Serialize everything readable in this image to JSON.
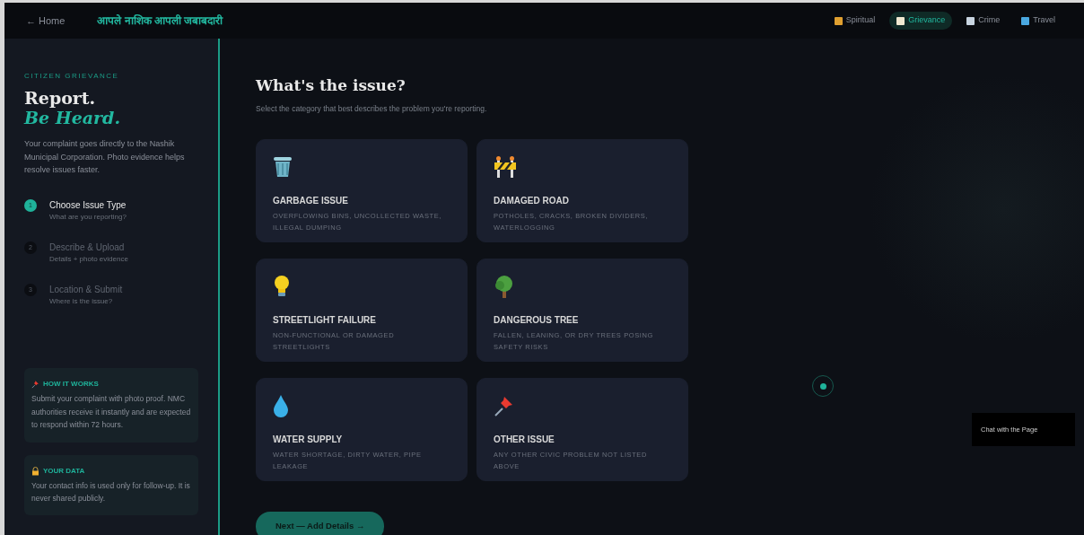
{
  "header": {
    "back": "← Home",
    "brand": "आपले नाशिक आपली जबाबदारी",
    "nav": [
      {
        "label": "Spiritual",
        "color": "#e0a030",
        "selected": false
      },
      {
        "label": "Grievance",
        "color": "#f0e8d0",
        "selected": true
      },
      {
        "label": "Crime",
        "color": "#c8d4e0",
        "selected": false
      },
      {
        "label": "Travel",
        "color": "#4aa8e0",
        "selected": false
      }
    ]
  },
  "sidebar": {
    "eyebrow": "CITIZEN GRIEVANCE",
    "title": "Report.",
    "title_accent": "Be Heard.",
    "intro": "Your complaint goes directly to the Nashik Municipal Corporation. Photo evidence helps resolve issues faster.",
    "steps": [
      {
        "number": "1",
        "title": "Choose Issue Type",
        "subtitle": "What are you reporting?",
        "selected": true
      },
      {
        "number": "2",
        "title": "Describe & Upload",
        "subtitle": "Details + photo evidence",
        "selected": false
      },
      {
        "number": "3",
        "title": "Location & Submit",
        "subtitle": "Where is the issue?",
        "selected": false
      }
    ],
    "info": [
      {
        "kind": "pin",
        "title": "HOW IT WORKS",
        "text": "Submit your complaint with photo proof. NMC authorities receive it instantly and are expected to respond within 72 hours."
      },
      {
        "kind": "lock",
        "title": "YOUR DATA",
        "text": "Your contact info is used only for follow-up. It is never shared publicly."
      }
    ]
  },
  "main": {
    "title": "What's the issue?",
    "subtitle": "Select the category that best describes the problem you're reporting.",
    "categories": [
      {
        "kind": "garbage",
        "title": "GARBAGE ISSUE",
        "text": "OVERFLOWING BINS, UNCOLLECTED WASTE, ILLEGAL DUMPING",
        "selected": false
      },
      {
        "kind": "road",
        "title": "DAMAGED ROAD",
        "text": "POTHOLES, CRACKS, BROKEN DIVIDERS, WATERLOGGING",
        "selected": false
      },
      {
        "kind": "light",
        "title": "STREETLIGHT FAILURE",
        "text": "NON-FUNCTIONAL OR DAMAGED STREETLIGHTS",
        "selected": false
      },
      {
        "kind": "tree",
        "title": "DANGEROUS TREE",
        "text": "FALLEN, LEANING, OR DRY TREES POSING SAFETY RISKS",
        "selected": false
      },
      {
        "kind": "water",
        "title": "WATER SUPPLY",
        "text": "WATER SHORTAGE, DIRTY WATER, PIPE LEAKAGE",
        "selected": false
      },
      {
        "kind": "pin",
        "title": "OTHER ISSUE",
        "text": "ANY OTHER CIVIC PROBLEM NOT LISTED ABOVE",
        "selected": false
      }
    ],
    "next": "Next — Add Details →"
  },
  "chat": {
    "label": "Chat with the Page"
  }
}
